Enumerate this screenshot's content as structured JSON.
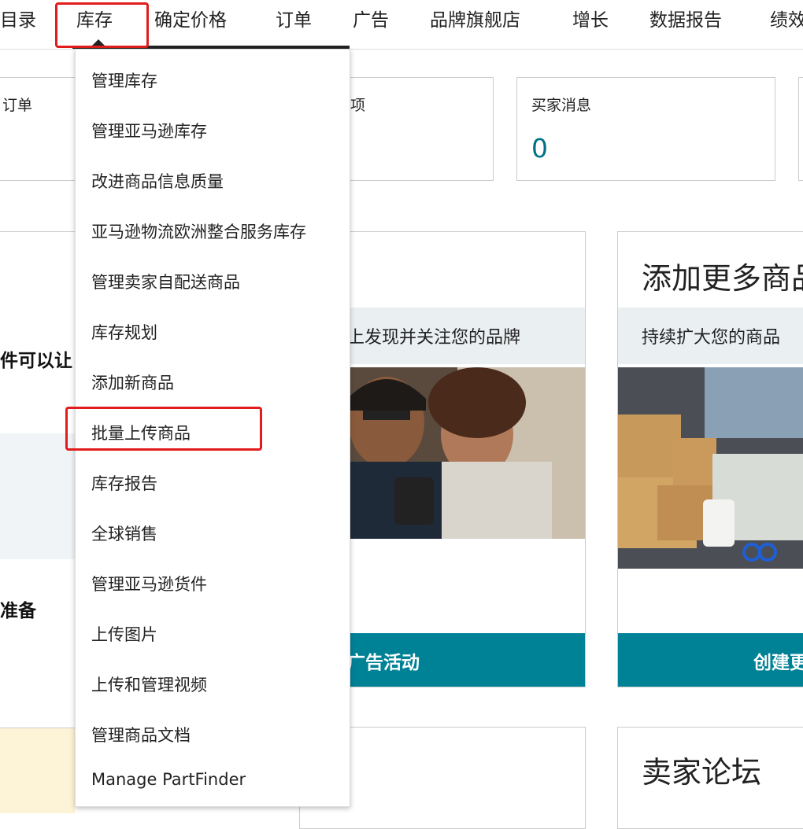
{
  "nav": {
    "items": [
      "目录",
      "库存",
      "确定价格",
      "订单",
      "广告",
      "品牌旗舰店",
      "增长",
      "数据报告",
      "绩效"
    ]
  },
  "stats": [
    {
      "title": "订单",
      "value": ""
    },
    {
      "title": "",
      "value": ""
    },
    {
      "title": "买家消息",
      "value": "0"
    }
  ],
  "left_panel": {
    "text1": "件可以让",
    "text2": "准备"
  },
  "cards": {
    "brand": {
      "band_text": "上发现并关注您的品牌",
      "button": "广告活动"
    },
    "add_products": {
      "title": "添加更多商品",
      "band_text": "持续扩大您的商品",
      "button": "创建更"
    },
    "forum": {
      "title": "卖家论坛"
    }
  },
  "dropdown": {
    "items": [
      "管理库存",
      "管理亚马逊库存",
      "改进商品信息质量",
      "亚马逊物流欧洲整合服务库存",
      "管理卖家自配送商品",
      "库存规划",
      "添加新商品",
      "批量上传商品",
      "库存报告",
      "全球销售",
      "管理亚马逊货件",
      "上传图片",
      "上传和管理视频",
      "管理商品文档",
      "Manage PartFinder"
    ]
  },
  "colors": {
    "accent_teal": "#008296",
    "highlight_red": "#e21c1c",
    "stat_value": "#007185"
  }
}
